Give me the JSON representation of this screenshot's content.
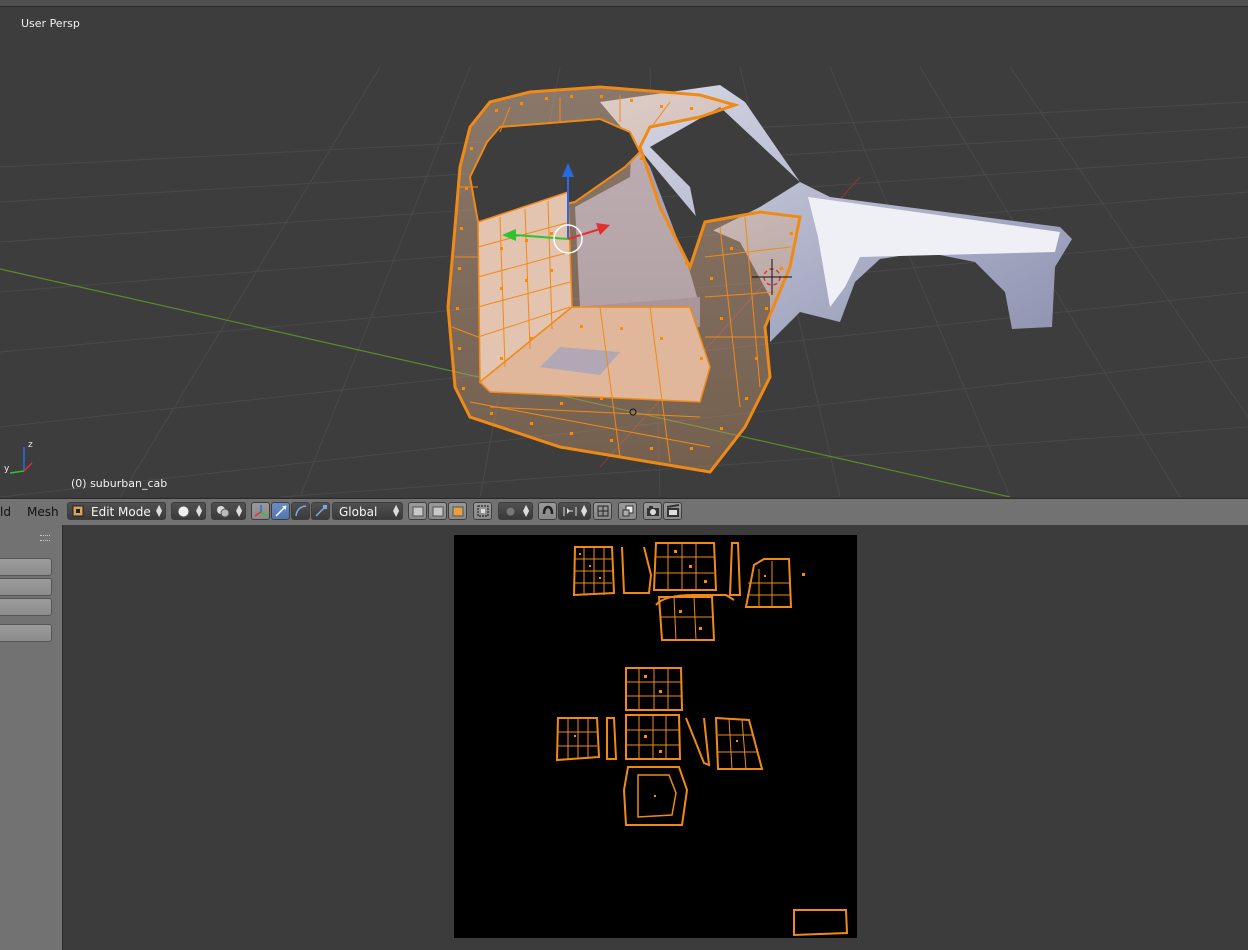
{
  "viewport": {
    "view_label": "User Persp",
    "object_label": "(0) suburban_cab",
    "axes": {
      "z": "z",
      "y": "y"
    }
  },
  "header": {
    "menu_left_cut": "ld",
    "mesh_menu": "Mesh",
    "mode_select": "Edit Mode",
    "orientation_select": "Global",
    "icons": [
      "mode-icon",
      "viewport-shading-icon",
      "pivot-point-icon",
      "manipulator-icon",
      "translate-icon",
      "rotate-icon",
      "scale-icon",
      "vertex-select-icon",
      "edge-select-icon",
      "face-select-icon",
      "limit-selection-icon",
      "proportional-edit-icon",
      "snap-icon",
      "snap-element-icon",
      "snap-target-icon",
      "render-icon",
      "render-animation-icon"
    ]
  },
  "colors": {
    "selection_orange": "#f08a17",
    "mesh_grey": "#b8bcd2",
    "viewport_bg": "#3d3d3d",
    "header_bg": "#727272",
    "uv_bg": "#000000"
  }
}
